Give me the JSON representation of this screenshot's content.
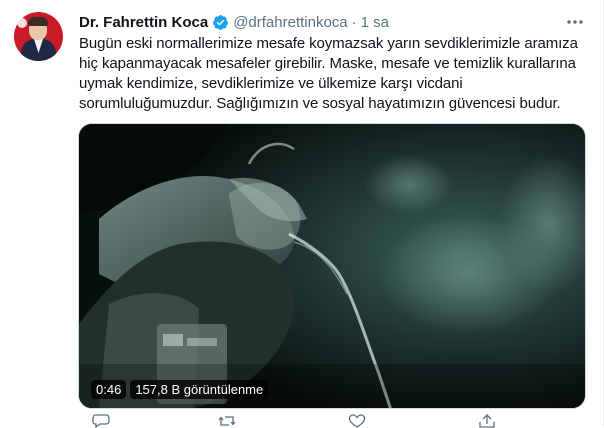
{
  "tweet": {
    "author_name": "Dr. Fahrettin Koca",
    "author_handle": "@drfahrettinkoca",
    "separator": "·",
    "timestamp": "1 sa",
    "verified": true,
    "text_lines": [
      "Bugün eski normallerimize mesafe koymazsak yarın sevdiklerimizle aramıza",
      "hiç kapanmayacak mesafeler girebilir. Maske, mesafe ve temizlik kurallarına",
      "uymak kendimize, sevdiklerimize ve ülkemize karşı vicdani",
      "sorumluluğumuzdur. Sağlığımızın ve sosyal hayatımızın güvencesi budur."
    ]
  },
  "video": {
    "duration": "0:46",
    "views": "157,8 B görüntülenme"
  },
  "colors": {
    "verified": "#1da1f2",
    "secondary_text": "#5b7083",
    "border": "#cfd9de"
  },
  "icons": {
    "verified": "verified-badge-icon",
    "more": "more-options-icon",
    "reply": "reply-icon",
    "retweet": "retweet-icon",
    "like": "like-icon",
    "share": "share-icon"
  }
}
